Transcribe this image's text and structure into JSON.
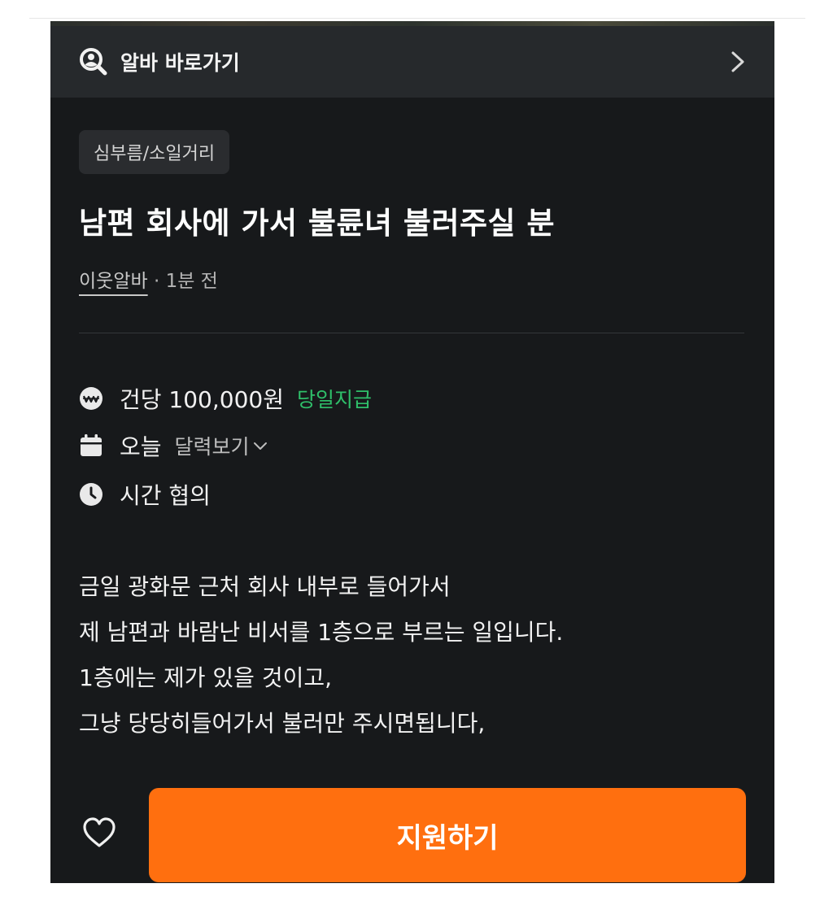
{
  "header": {
    "label": "알바 바로가기",
    "search_icon": "search-person-icon",
    "chevron_icon": "chevron-right-icon"
  },
  "post": {
    "category": "심부름/소일거리",
    "title": "남편 회사에 가서 불륜녀 불러주실 분",
    "poster": "이웃알바",
    "separator": " · ",
    "time_ago": "1분 전"
  },
  "details": {
    "pay": {
      "icon": "won-icon",
      "text": "건당 100,000원",
      "badge": "당일지급"
    },
    "date": {
      "icon": "calendar-icon",
      "text": "오늘",
      "link": "달력보기"
    },
    "time": {
      "icon": "clock-icon",
      "text": "시간 협의"
    }
  },
  "description": {
    "lines": [
      "금일 광화문 근처 회사 내부로 들어가서",
      "제 남편과 바람난 비서를 1층으로 부르는 일입니다.",
      "1층에는 제가 있을 것이고,",
      "그냥 당당히들어가서 불러만 주시면됩니다,"
    ]
  },
  "footer": {
    "like_icon": "heart-outline-icon",
    "apply_label": "지원하기"
  },
  "colors": {
    "background": "#17191b",
    "header": "#26292c",
    "accent": "#ff6f0f",
    "badge_green": "#2fbf6a"
  }
}
